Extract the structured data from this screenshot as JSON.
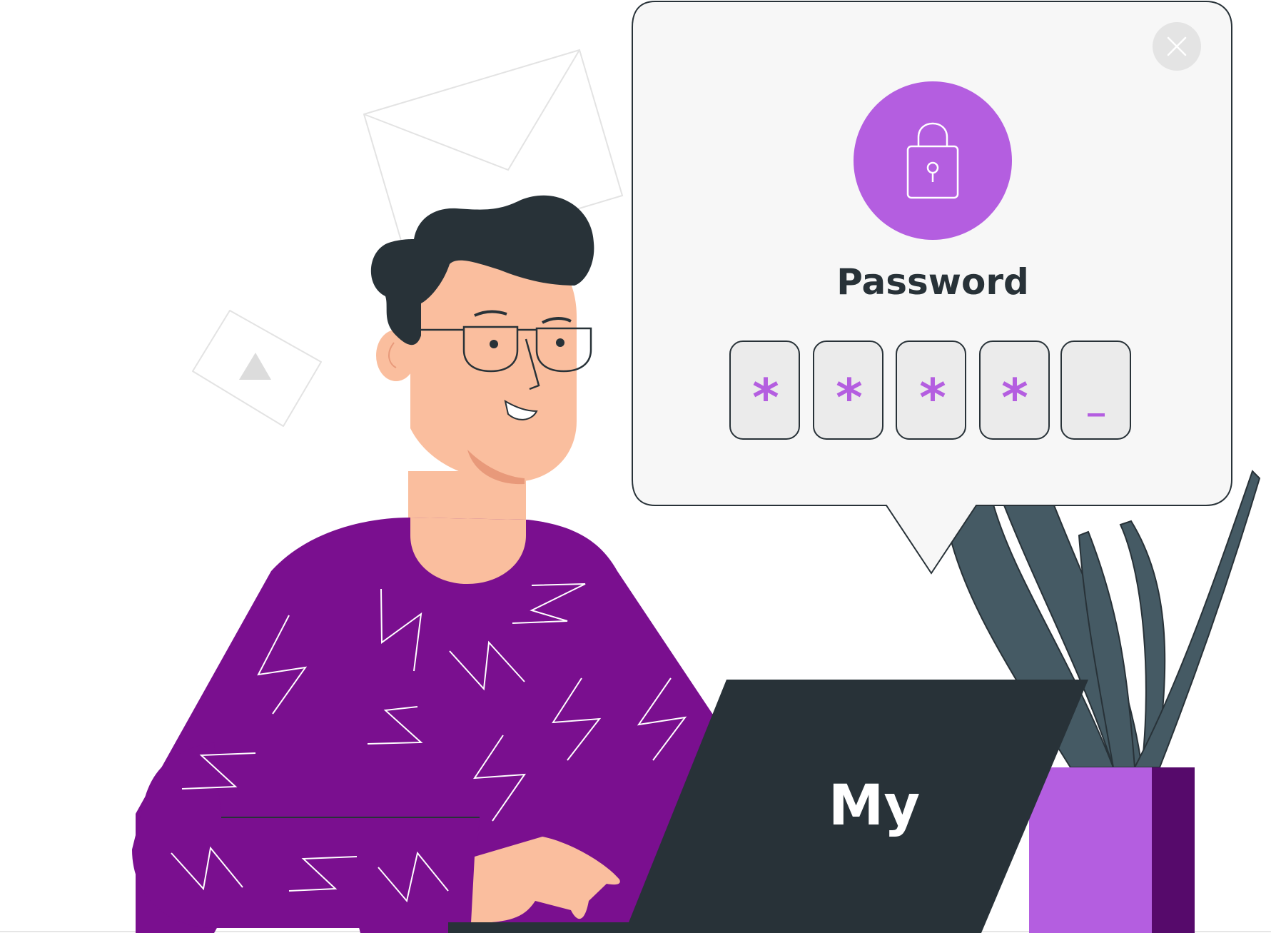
{
  "dialog": {
    "title": "Password",
    "close_icon": "close-icon",
    "lock_icon": "lock-icon",
    "pin": [
      "*",
      "*",
      "*",
      "*",
      "_"
    ],
    "accent_color": "#B45EE0"
  },
  "laptop": {
    "brand": "My"
  },
  "background": {
    "envelope_icon": "envelope-icon",
    "play_icon": "play-icon"
  },
  "colors": {
    "sweater": "#7A0F8F",
    "skin": "#FABE9E",
    "hair": "#283238",
    "laptop": "#283238",
    "pot": "#B45EE0",
    "pot_shade": "#560A6B",
    "plant": "#455A64"
  }
}
